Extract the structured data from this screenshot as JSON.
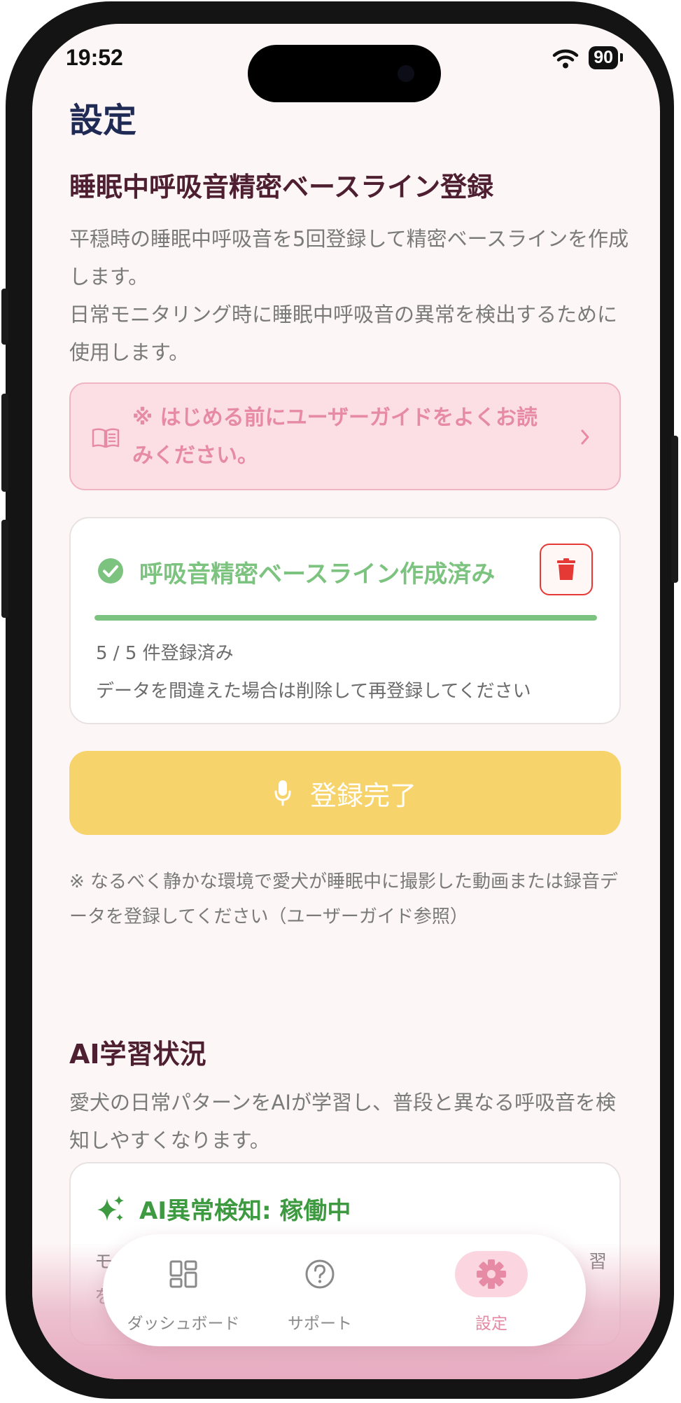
{
  "status_bar": {
    "time": "19:52",
    "battery": "90"
  },
  "page": {
    "title": "設定"
  },
  "baseline": {
    "title": "睡眠中呼吸音精密ベースライン登録",
    "description": "平穏時の睡眠中呼吸音を5回登録して精密ベースラインを作成します。\n日常モニタリング時に睡眠中呼吸音の異常を検出するために使用します。",
    "guide_notice": "※ はじめる前にユーザーガイドをよくお読みください。",
    "status_card": {
      "status": "呼吸音精密ベースライン作成済み",
      "progress": 1.0,
      "count_text": "5 / 5 件登録済み",
      "note": "データを間違えた場合は削除して再登録してください"
    },
    "register_button": "登録完了",
    "footnote": "※ なるべく静かな環境で愛犬が睡眠中に撮影した動画または録音データを登録してください（ユーザーガイド参照）"
  },
  "ai": {
    "title": "AI学習状況",
    "description": "愛犬の日常パターンをAIが学習し、普段と異なる呼吸音を検知しやすくなります。",
    "card_title": "AI異常検知: 稼働中",
    "partial_left_1": "モ",
    "partial_left_2": "を",
    "partial_right": "習"
  },
  "nav": {
    "items": [
      {
        "label": "ダッシュボード",
        "icon": "dashboard-icon"
      },
      {
        "label": "サポート",
        "icon": "help-icon"
      },
      {
        "label": "設定",
        "icon": "gear-icon"
      }
    ],
    "active": "設定"
  },
  "colors": {
    "background": "#fdf6f6",
    "title_dark": "#4e1f30",
    "pink_accent": "#e68aa5",
    "success_green": "#7cc37f",
    "ai_green": "#3e9a41",
    "button_yellow": "#f7d46b",
    "danger_red": "#e53935"
  }
}
